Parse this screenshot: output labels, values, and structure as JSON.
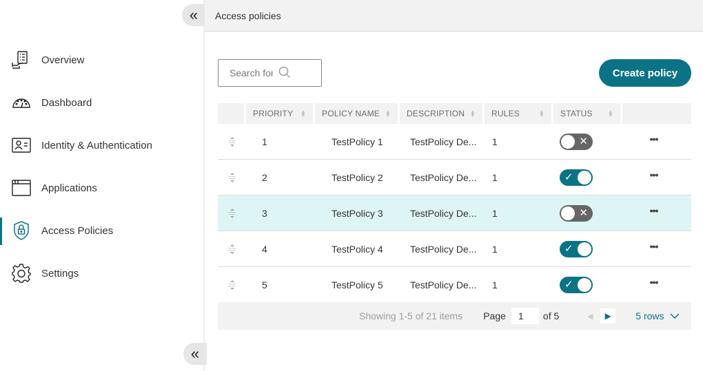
{
  "sidebar": {
    "collapse_glyph": "«",
    "items": [
      {
        "label": "Overview",
        "icon": "overview-icon",
        "active": false
      },
      {
        "label": "Dashboard",
        "icon": "dashboard-icon",
        "active": false
      },
      {
        "label": "Identity & Authentication",
        "icon": "identity-card-icon",
        "active": false
      },
      {
        "label": "Applications",
        "icon": "applications-window-icon",
        "active": false
      },
      {
        "label": "Access Policies",
        "icon": "shield-lock-icon",
        "active": true
      },
      {
        "label": "Settings",
        "icon": "gear-icon",
        "active": false
      }
    ]
  },
  "header": {
    "title": "Access policies"
  },
  "search": {
    "placeholder": "Search for access policies",
    "visible_text": "Search for acces"
  },
  "toolbar": {
    "create_label": "Create policy"
  },
  "colors": {
    "accent": "#0b7385",
    "highlight_row": "#def5f5",
    "toggle_off": "#666666"
  },
  "table": {
    "columns": [
      "PRIORITY",
      "POLICY NAME",
      "DESCRIPTION",
      "RULES",
      "STATUS"
    ],
    "rows": [
      {
        "priority": "1",
        "name": "TestPolicy 1",
        "description": "TestPolicy De...",
        "rules": "1",
        "status": "off",
        "highlighted": false
      },
      {
        "priority": "2",
        "name": "TestPolicy 2",
        "description": "TestPolicy De...",
        "rules": "1",
        "status": "on",
        "highlighted": false
      },
      {
        "priority": "3",
        "name": "TestPolicy 3",
        "description": "TestPolicy De...",
        "rules": "1",
        "status": "off",
        "highlighted": true
      },
      {
        "priority": "4",
        "name": "TestPolicy 4",
        "description": "TestPolicy De...",
        "rules": "1",
        "status": "on",
        "highlighted": false
      },
      {
        "priority": "5",
        "name": "TestPolicy 5",
        "description": "TestPolicy De...",
        "rules": "1",
        "status": "on",
        "highlighted": false
      }
    ],
    "row_action_glyph": "•••"
  },
  "pagination": {
    "showing": "Showing 1-5 of 21 items",
    "page_label": "Page",
    "current_page": "1",
    "of_label": "of 5",
    "rows_label": "5 rows"
  }
}
